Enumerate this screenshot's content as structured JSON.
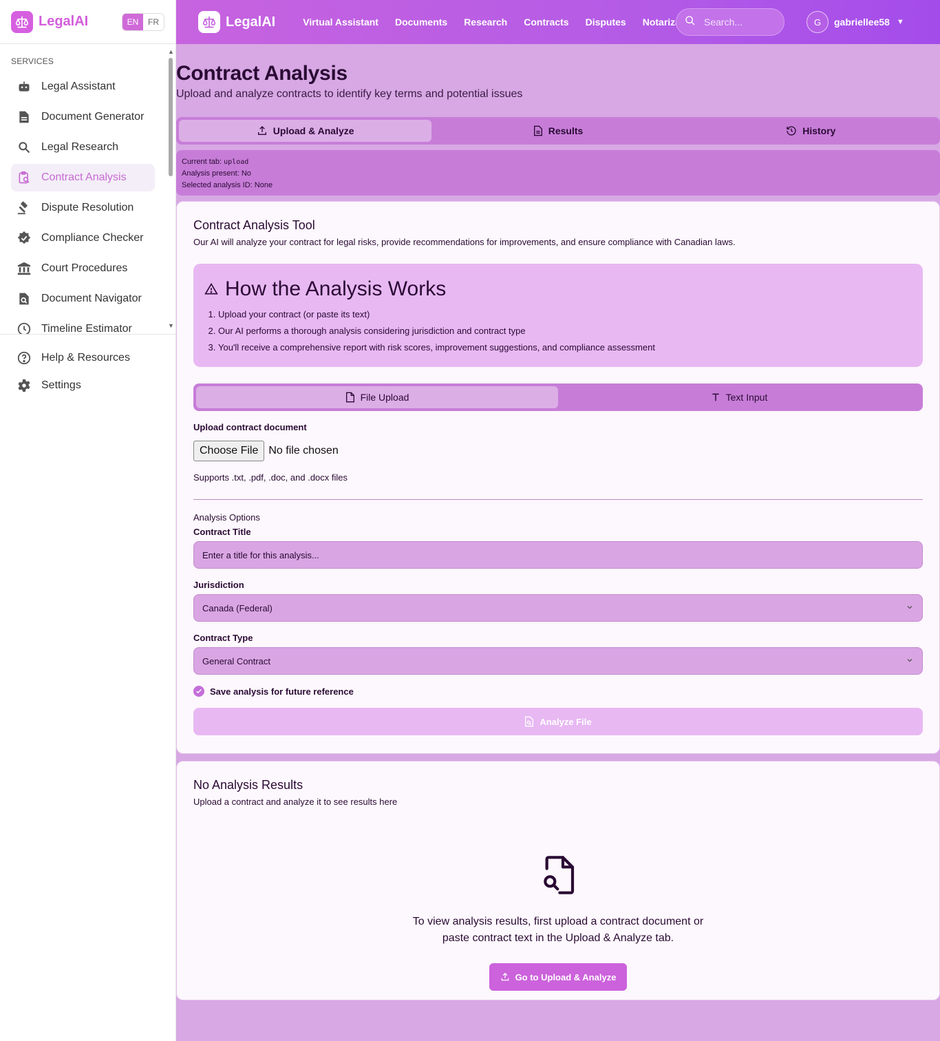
{
  "app": {
    "name": "LegalAI"
  },
  "lang": {
    "en": "EN",
    "fr": "FR"
  },
  "sidebar": {
    "section_label": "SERVICES",
    "items": [
      {
        "label": "Legal Assistant",
        "icon": "robot-icon"
      },
      {
        "label": "Document Generator",
        "icon": "document-icon"
      },
      {
        "label": "Legal Research",
        "icon": "search-icon"
      },
      {
        "label": "Contract Analysis",
        "icon": "clipboard-search-icon",
        "active": true
      },
      {
        "label": "Dispute Resolution",
        "icon": "gavel-icon"
      },
      {
        "label": "Compliance Checker",
        "icon": "badge-check-icon"
      },
      {
        "label": "Court Procedures",
        "icon": "courthouse-icon"
      },
      {
        "label": "Document Navigator",
        "icon": "file-search-icon"
      },
      {
        "label": "Timeline Estimator",
        "icon": "clock-icon"
      }
    ],
    "bottom": [
      {
        "label": "Help & Resources",
        "icon": "help-circle-icon"
      },
      {
        "label": "Settings",
        "icon": "gear-icon"
      }
    ]
  },
  "topbar": {
    "nav": [
      "Virtual Assistant",
      "Documents",
      "Research",
      "Contracts",
      "Disputes",
      "Notarization"
    ],
    "search_placeholder": "Search...",
    "user": {
      "initial": "G",
      "name": "gabriellee58"
    }
  },
  "page": {
    "title": "Contract Analysis",
    "subtitle": "Upload and analyze contracts to identify key terms and potential issues",
    "tabs": [
      "Upload & Analyze",
      "Results",
      "History"
    ],
    "debug": {
      "current_tab_label": "Current tab: ",
      "current_tab_value": "upload",
      "analysis_present": "Analysis present: No",
      "selected_id": "Selected analysis ID: None"
    }
  },
  "tool_card": {
    "title": "Contract Analysis Tool",
    "description": "Our AI will analyze your contract for legal risks, provide recommendations for improvements, and ensure compliance with Canadian laws.",
    "how": {
      "title": "How the Analysis Works",
      "steps": [
        "Upload your contract (or paste its text)",
        "Our AI performs a thorough analysis considering jurisdiction and contract type",
        "You'll receive a comprehensive report with risk scores, improvement suggestions, and compliance assessment"
      ]
    },
    "input_tabs": [
      "File Upload",
      "Text Input"
    ],
    "upload_label": "Upload contract document",
    "choose_file": "Choose File",
    "no_file": "No file chosen",
    "supports": "Supports .txt, .pdf, .doc, and .docx files",
    "options_label": "Analysis Options",
    "contract_title_label": "Contract Title",
    "contract_title_placeholder": "Enter a title for this analysis...",
    "jurisdiction_label": "Jurisdiction",
    "jurisdiction_value": "Canada (Federal)",
    "contract_type_label": "Contract Type",
    "contract_type_value": "General Contract",
    "save_label": "Save analysis for future reference",
    "analyze_button": "Analyze File"
  },
  "results_card": {
    "title": "No Analysis Results",
    "description": "Upload a contract and analyze it to see results here",
    "empty_text": "To view analysis results, first upload a contract document or paste contract text in the Upload & Analyze tab.",
    "button": "Go to Upload & Analyze"
  }
}
